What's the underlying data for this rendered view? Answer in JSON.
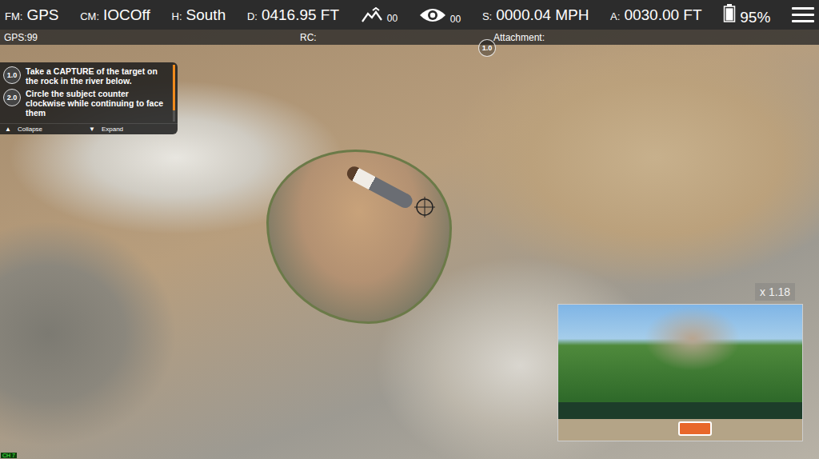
{
  "top_bar": {
    "readouts": [
      {
        "kind": "text",
        "label": "FM:",
        "value": "GPS"
      },
      {
        "kind": "text",
        "label": "CM:",
        "value": "IOCOff"
      },
      {
        "kind": "text",
        "label": "H:",
        "value": "South"
      },
      {
        "kind": "text",
        "label": "D:",
        "value": "0416.95 FT"
      },
      {
        "kind": "signal",
        "value": "00"
      },
      {
        "kind": "eye",
        "value": "00"
      },
      {
        "kind": "text",
        "label": "S:",
        "value": "0000.04 MPH"
      },
      {
        "kind": "text",
        "label": "A:",
        "value": "0030.00 FT"
      },
      {
        "kind": "battery",
        "value": "95%",
        "level": 0.95
      }
    ]
  },
  "status_row": [
    "GPS:99",
    "RC:",
    "Attachment:"
  ],
  "mission": {
    "tasks": [
      {
        "number": "1.0",
        "text": "Take a CAPTURE of the target on the rock in the river below."
      },
      {
        "number": "2.0",
        "text": "Circle the subject counter clockwise while continuing to face them"
      }
    ],
    "scrollbar": {
      "level": 0.8
    },
    "collapse": {
      "icon": "▲",
      "label": "Collapse"
    },
    "expand": {
      "icon": "▼",
      "label": "Expand"
    }
  },
  "waypoint": {
    "number": "1.0"
  },
  "camera_inset": {
    "zoom": "x 1.18"
  },
  "channel": "CH 7"
}
